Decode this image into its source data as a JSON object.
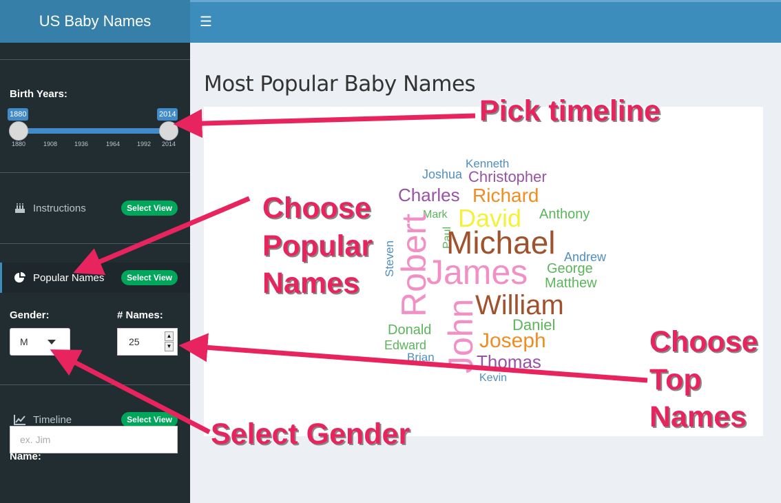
{
  "app": {
    "title": "US Baby Names"
  },
  "header": {
    "menu_icon": "hamburger-icon"
  },
  "sidebar": {
    "birth_years": {
      "label": "Birth Years:",
      "min": 1880,
      "max": 2014,
      "from": "1880",
      "to": "2014",
      "ticks": [
        "1880",
        "1908",
        "1936",
        "1964",
        "1992",
        "2014"
      ]
    },
    "items": [
      {
        "label": "Instructions",
        "icon": "birthday-cake-icon",
        "badge": "Select View"
      },
      {
        "label": "Popular Names",
        "icon": "pie-chart-icon",
        "badge": "Select View"
      },
      {
        "label": "Timeline",
        "icon": "line-chart-icon",
        "badge": "Select View"
      }
    ],
    "gender": {
      "label": "Gender:",
      "value": "M"
    },
    "num_names": {
      "label": "# Names:",
      "value": "25"
    },
    "name": {
      "label": "Name:",
      "placeholder": "ex. Jim"
    }
  },
  "main": {
    "title": "Most Popular Baby Names",
    "wordcloud": [
      {
        "text": "Kenneth",
        "color": "#4f8fc0"
      },
      {
        "text": "Joshua",
        "color": "#4f8fc0"
      },
      {
        "text": "Christopher",
        "color": "#9a52a7"
      },
      {
        "text": "Charles",
        "color": "#9a52a7"
      },
      {
        "text": "Richard",
        "color": "#f08d22"
      },
      {
        "text": "Mark",
        "color": "#5bb55b"
      },
      {
        "text": "David",
        "color": "#f5f13a"
      },
      {
        "text": "Anthony",
        "color": "#5bb55b"
      },
      {
        "text": "Paul",
        "color": "#5bb55b"
      },
      {
        "text": "Michael",
        "color": "#a0522d"
      },
      {
        "text": "Robert",
        "color": "#f28fc5"
      },
      {
        "text": "Steven",
        "color": "#4f8fc0"
      },
      {
        "text": "Andrew",
        "color": "#4f8fc0"
      },
      {
        "text": "George",
        "color": "#5bb55b"
      },
      {
        "text": "James",
        "color": "#f28fc5"
      },
      {
        "text": "Matthew",
        "color": "#5bb55b"
      },
      {
        "text": "John",
        "color": "#f28fc5"
      },
      {
        "text": "William",
        "color": "#a0522d"
      },
      {
        "text": "Daniel",
        "color": "#5bb55b"
      },
      {
        "text": "Donald",
        "color": "#5bb55b"
      },
      {
        "text": "Joseph",
        "color": "#f08d22"
      },
      {
        "text": "Edward",
        "color": "#5bb55b"
      },
      {
        "text": "Brian",
        "color": "#4f8fc0"
      },
      {
        "text": "Thomas",
        "color": "#9a52a7"
      },
      {
        "text": "Kevin",
        "color": "#4f8fc0"
      }
    ]
  },
  "annotations": {
    "color": "#e8245f",
    "pick_timeline": "Pick  timeline",
    "choose_popular": [
      "Choose",
      "Popular",
      "Names"
    ],
    "choose_top": [
      "Choose",
      "Top",
      "Names"
    ],
    "select_gender": "Select Gender"
  }
}
